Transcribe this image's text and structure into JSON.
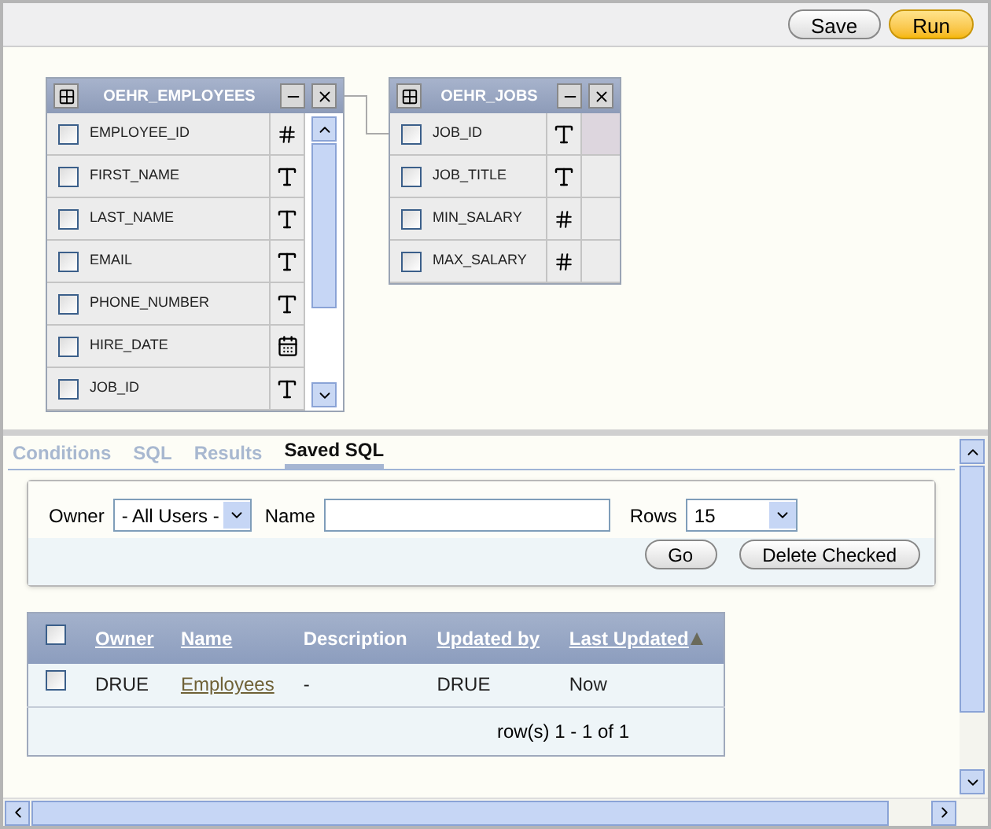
{
  "toolbar": {
    "buttons": [
      {
        "label": "Save",
        "kind": "default"
      },
      {
        "label": "Run",
        "kind": "primary"
      }
    ]
  },
  "tables": [
    {
      "name": "OEHR_EMPLOYEES",
      "scrollable": true,
      "columns": [
        {
          "name": "EMPLOYEE_ID",
          "kind": "number",
          "checked": false
        },
        {
          "name": "FIRST_NAME",
          "kind": "text",
          "checked": false
        },
        {
          "name": "LAST_NAME",
          "kind": "text",
          "checked": false
        },
        {
          "name": "EMAIL",
          "kind": "text",
          "checked": false
        },
        {
          "name": "PHONE_NUMBER",
          "kind": "text",
          "checked": false
        },
        {
          "name": "HIRE_DATE",
          "kind": "date",
          "checked": false
        },
        {
          "name": "JOB_ID",
          "kind": "text",
          "checked": false
        }
      ]
    },
    {
      "name": "OEHR_JOBS",
      "scrollable": false,
      "columns": [
        {
          "name": "JOB_ID",
          "kind": "text",
          "checked": false
        },
        {
          "name": "JOB_TITLE",
          "kind": "text",
          "checked": false
        },
        {
          "name": "MIN_SALARY",
          "kind": "number",
          "checked": false
        },
        {
          "name": "MAX_SALARY",
          "kind": "number",
          "checked": false
        }
      ]
    }
  ],
  "tabs": [
    {
      "label": "Conditions",
      "selected": false
    },
    {
      "label": "SQL",
      "selected": false
    },
    {
      "label": "Results",
      "selected": false
    },
    {
      "label": "Saved SQL",
      "selected": true
    }
  ],
  "filter": {
    "owner_label": "Owner",
    "owner_value": "- All Users -",
    "name_label": "Name",
    "rows_label": "Rows",
    "rows_value": "15",
    "go": "Go",
    "delete": "Delete Checked"
  },
  "results": {
    "all_checked": false,
    "columns": [
      {
        "label": "Owner",
        "link": true
      },
      {
        "label": "Name",
        "link": true
      },
      {
        "label": "Description",
        "link": false
      },
      {
        "label": "Updated by",
        "link": true
      },
      {
        "label": "Last Updated",
        "link": true,
        "sorted": true
      }
    ],
    "rows": [
      {
        "checked": false,
        "cells": [
          "DRUE",
          "Employees",
          "-",
          "DRUE",
          "Now"
        ]
      }
    ],
    "footer": "row(s) 1 - 1 of 1"
  }
}
